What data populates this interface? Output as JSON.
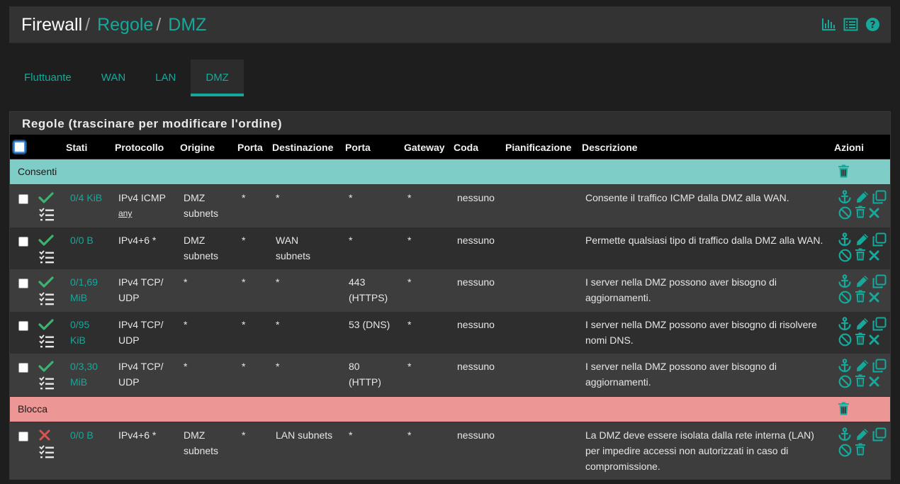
{
  "breadcrumb": {
    "root": "Firewall",
    "sep": "/",
    "level1": "Regole",
    "level2": "DMZ"
  },
  "header_icons": [
    "bar-chart-icon",
    "list-icon",
    "help-icon"
  ],
  "tabs": [
    {
      "label": "Fluttuante",
      "active": false
    },
    {
      "label": "WAN",
      "active": false
    },
    {
      "label": "LAN",
      "active": false
    },
    {
      "label": "DMZ",
      "active": true
    }
  ],
  "panel": {
    "title": "Regole (trascinare per modificare l'ordine)"
  },
  "columns": {
    "stati": "Stati",
    "protocollo": "Protocollo",
    "origine": "Origine",
    "porta_src": "Porta",
    "destinazione": "Destinazione",
    "porta_dst": "Porta",
    "gateway": "Gateway",
    "coda": "Coda",
    "pianificazione": "Pianificazione",
    "descrizione": "Descrizione",
    "azioni": "Azioni"
  },
  "separators": {
    "allow": {
      "label": "Consenti",
      "color": "#7ecdc6"
    },
    "block": {
      "label": "Blocca",
      "color": "#ec9696"
    }
  },
  "rows": [
    {
      "pass": true,
      "states_line1": "0/4 KiB",
      "states_line2": "",
      "proto_line1": "IPv4 ICMP",
      "proto_line2": "any",
      "src_line1": "DMZ",
      "src_line2": "subnets",
      "sport": "*",
      "dst_line1": "*",
      "dst_line2": "",
      "dport_line1": "*",
      "dport_line2": "",
      "gw": "*",
      "queue": "nessuno",
      "sched": "",
      "desc": "Consente il traffico ICMP dalla DMZ alla WAN."
    },
    {
      "pass": true,
      "states_line1": "0/0 B",
      "states_line2": "",
      "proto_line1": "IPv4+6 *",
      "proto_line2": "",
      "src_line1": "DMZ",
      "src_line2": "subnets",
      "sport": "*",
      "dst_line1": "WAN",
      "dst_line2": "subnets",
      "dport_line1": "*",
      "dport_line2": "",
      "gw": "*",
      "queue": "nessuno",
      "sched": "",
      "desc": "Permette qualsiasi tipo di traffico dalla DMZ alla WAN."
    },
    {
      "pass": true,
      "states_line1": "0/1,69",
      "states_line2": "MiB",
      "proto_line1": "IPv4 TCP/",
      "proto_line2": "UDP",
      "src_line1": "*",
      "src_line2": "",
      "sport": "*",
      "dst_line1": "*",
      "dst_line2": "",
      "dport_line1": "443",
      "dport_line2": "(HTTPS)",
      "gw": "*",
      "queue": "nessuno",
      "sched": "",
      "desc": "I server nella DMZ possono aver bisogno di aggiornamenti."
    },
    {
      "pass": true,
      "states_line1": "0/95",
      "states_line2": "KiB",
      "proto_line1": "IPv4 TCP/",
      "proto_line2": "UDP",
      "src_line1": "*",
      "src_line2": "",
      "sport": "*",
      "dst_line1": "*",
      "dst_line2": "",
      "dport_line1": "53 (DNS)",
      "dport_line2": "",
      "gw": "*",
      "queue": "nessuno",
      "sched": "",
      "desc": "I server nella DMZ possono aver bisogno di risolvere nomi DNS."
    },
    {
      "pass": true,
      "states_line1": "0/3,30",
      "states_line2": "MiB",
      "proto_line1": "IPv4 TCP/",
      "proto_line2": "UDP",
      "src_line1": "*",
      "src_line2": "",
      "sport": "*",
      "dst_line1": "*",
      "dst_line2": "",
      "dport_line1": "80",
      "dport_line2": "(HTTP)",
      "gw": "*",
      "queue": "nessuno",
      "sched": "",
      "desc": "I server nella DMZ possono aver bisogno di aggiornamenti."
    },
    {
      "pass": false,
      "states_line1": "0/0 B",
      "states_line2": "",
      "proto_line1": "IPv4+6 *",
      "proto_line2": "",
      "src_line1": "DMZ",
      "src_line2": "subnets",
      "sport": "*",
      "dst_line1": "LAN subnets",
      "dst_line2": "",
      "dport_line1": "*",
      "dport_line2": "",
      "gw": "*",
      "queue": "nessuno",
      "sched": "",
      "desc": "La DMZ deve essere isolata dalla rete interna (LAN) per impedire accessi non autorizzati in caso di compromissione."
    }
  ],
  "colors": {
    "accent": "#16a89a",
    "pass": "#3cb371",
    "block": "#d9534f"
  }
}
